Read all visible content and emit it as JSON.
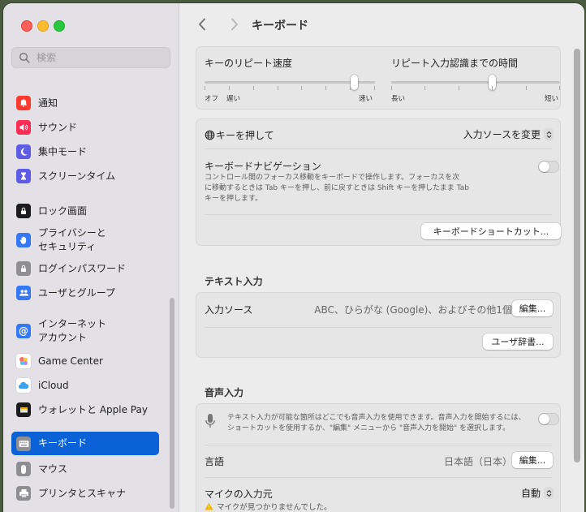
{
  "sidebar": {
    "search_placeholder": "検索",
    "items": [
      {
        "label": "通知",
        "color": "#ff3b30"
      },
      {
        "label": "サウンド",
        "color": "#ff2d55"
      },
      {
        "label": "集中モード",
        "color": "#5e5ce6"
      },
      {
        "label": "スクリーンタイム",
        "color": "#5e5ce6"
      },
      {
        "label": "ロック画面",
        "color": "#1c1c1e"
      },
      {
        "label": "プライバシーと\nセキュリティ",
        "color": "#3478f6"
      },
      {
        "label": "ログインパスワード",
        "color": "#8e8e93"
      },
      {
        "label": "ユーザとグループ",
        "color": "#3478f6"
      },
      {
        "label": "インターネット\nアカウント",
        "color": "#3478f6"
      },
      {
        "label": "Game Center",
        "color": "#ffffff"
      },
      {
        "label": "iCloud",
        "color": "#ffffff"
      },
      {
        "label": "ウォレットと Apple Pay",
        "color": "#1c1c1e"
      },
      {
        "label": "キーボード",
        "color": "#8e8e93"
      },
      {
        "label": "マウス",
        "color": "#8e8e93"
      },
      {
        "label": "プリンタとスキャナ",
        "color": "#8e8e93"
      }
    ],
    "selected_index": 12
  },
  "header": {
    "title": "キーボード"
  },
  "repeat": {
    "key_repeat_label": "キーのリピート速度",
    "key_repeat_min": "オフ",
    "key_repeat_slow": "遅い",
    "key_repeat_fast": "速い",
    "key_repeat_value": 0.88,
    "delay_label": "リピート入力認識までの時間",
    "delay_long": "長い",
    "delay_short": "短い",
    "delay_value": 0.6
  },
  "keyboard": {
    "globe_label": "キーを押して",
    "globe_value": "入力ソースを変更",
    "nav_label": "キーボードナビゲーション",
    "nav_desc": "コントロール間のフォーカス移動をキーボードで操作します。フォーカスを次\nに移動するときは Tab キーを押し、前に戻すときは Shift キーを押したまま Tab\nキーを押します。",
    "nav_enabled": false,
    "shortcuts_button": "キーボードショートカット..."
  },
  "text_input": {
    "section_title": "テキスト入力",
    "sources_label": "入力ソース",
    "sources_value": "ABC、ひらがな (Google)、およびその他1個",
    "edit_button": "編集...",
    "dictionary_button": "ユーザ辞書..."
  },
  "dictation": {
    "section_title": "音声入力",
    "desc": "テキスト入力が可能な箇所はどこでも音声入力を使用できます。音声入力を開始するには、\nショートカットを使用するか、\"編集\" メニューから \"音声入力を開始\" を選択します。",
    "enabled": false,
    "language_label": "言語",
    "language_value": "日本語（日本）",
    "edit_button": "編集...",
    "mic_label": "マイクの入力元",
    "mic_value": "自動",
    "mic_warning": "マイクが見つかりませんでした。"
  }
}
